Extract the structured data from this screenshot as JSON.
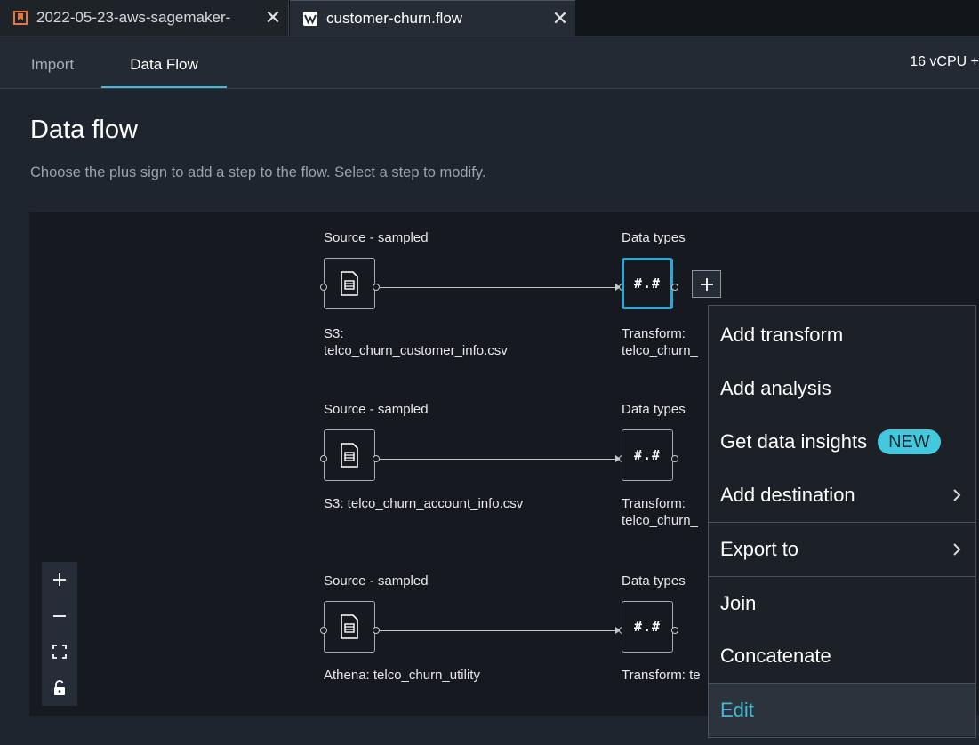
{
  "tabs": [
    {
      "label": "2022-05-23-aws-sagemaker-",
      "close": "✕",
      "icon": "bookmark-icon",
      "accent": "#e8763f"
    },
    {
      "label": "customer-churn.flow",
      "close": "✕",
      "icon": "data-wrangler-icon",
      "accent": "#ffffff"
    }
  ],
  "subnav": {
    "import": "Import",
    "data_flow": "Data Flow",
    "compute": "16 vCPU +"
  },
  "page": {
    "title": "Data flow",
    "description": "Choose the plus sign to add a step to the flow. Select a step to modify."
  },
  "flows": [
    {
      "source_heading": "Source - sampled",
      "source_name": "S3:\ntelco_churn_customer_info.csv",
      "dest_heading": "Data types",
      "dest_symbol": "#.#",
      "dest_name": "Transform:\ntelco_churn_"
    },
    {
      "source_heading": "Source - sampled",
      "source_name": "S3: telco_churn_account_info.csv",
      "dest_heading": "Data types",
      "dest_symbol": "#.#",
      "dest_name": "Transform:\ntelco_churn_"
    },
    {
      "source_heading": "Source - sampled",
      "source_name": "Athena: telco_churn_utility",
      "dest_heading": "Data types",
      "dest_symbol": "#.#",
      "dest_name": "Transform: te"
    }
  ],
  "add_step": "+",
  "menu": {
    "add_transform": "Add transform",
    "add_analysis": "Add analysis",
    "get_data_insights": "Get data insights",
    "new_badge": "NEW",
    "add_destination": "Add destination",
    "export_to": "Export to",
    "join": "Join",
    "concatenate": "Concatenate",
    "edit": "Edit"
  },
  "zoom": [
    "zoom-in-icon",
    "zoom-out-icon",
    "fit-view-icon",
    "unlock-icon"
  ],
  "colors": {
    "accent": "#44b9d6",
    "badge": "#44c8de",
    "selected_border": "#2ea8d3"
  }
}
